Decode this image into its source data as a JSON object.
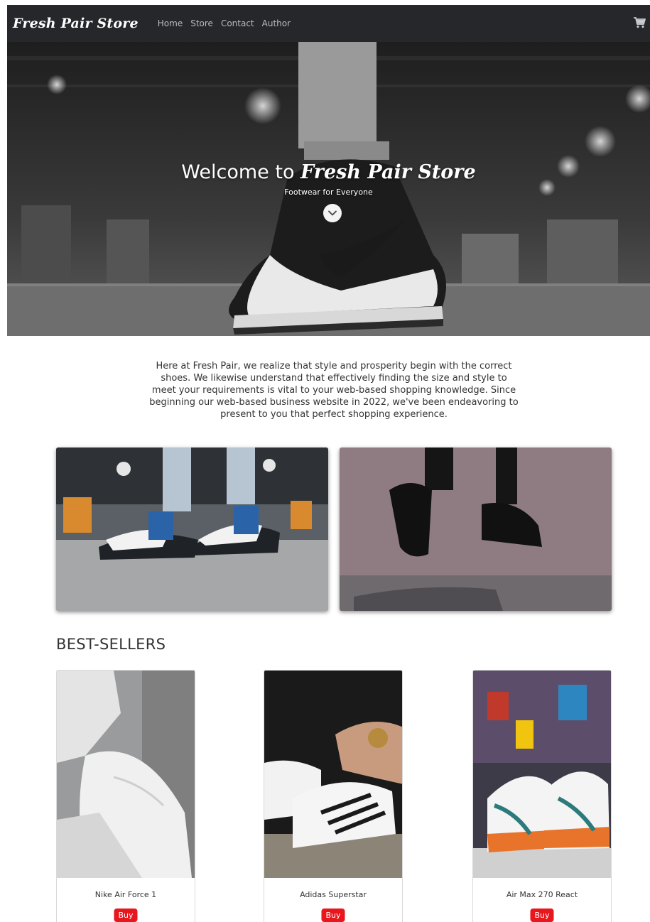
{
  "nav": {
    "brand": "Fresh Pair Store",
    "links": [
      "Home",
      "Store",
      "Contact",
      "Author"
    ],
    "cart_icon": "shopping-cart-icon"
  },
  "hero": {
    "title_prefix": "Welcome to ",
    "title_brand": "Fresh Pair Store",
    "subtitle": "Footwear for Everyone",
    "scroll_icon": "chevron-down-icon"
  },
  "intro": {
    "text": "Here at Fresh Pair, we realize that style and prosperity begin with the correct shoes. We likewise understand that effectively finding the size and style to meet your requirements is vital to your web-based shopping knowledge. Since beginning our web-based business website in 2022, we've been endeavoring to present to you that perfect shopping experience."
  },
  "best_sellers": {
    "title": "BEST-SELLERS",
    "products": [
      {
        "name": "Nike Air Force 1",
        "buy_label": "Buy"
      },
      {
        "name": "Adidas Superstar",
        "buy_label": "Buy"
      },
      {
        "name": "Air Max 270 React",
        "buy_label": "Buy"
      }
    ]
  },
  "colors": {
    "navbar": "#25272b",
    "buy_button": "#e8161d"
  }
}
